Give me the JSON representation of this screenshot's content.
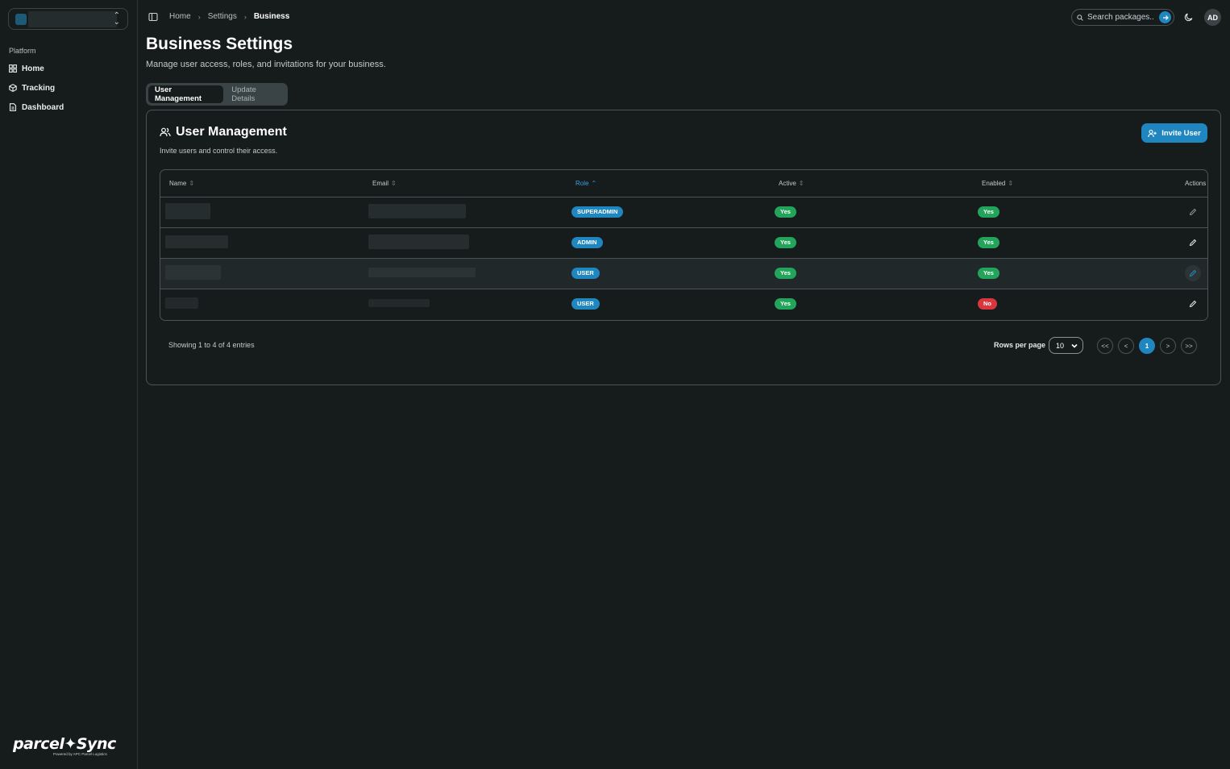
{
  "sidebar": {
    "group_label": "Platform",
    "items": [
      {
        "label": "Home"
      },
      {
        "label": "Tracking"
      },
      {
        "label": "Dashboard"
      }
    ],
    "brand_wordmark": "parcel✦Sync",
    "brand_tagline": "Powered by APC Parcel Logistics"
  },
  "breadcrumb": [
    "Home",
    "Settings",
    "Business"
  ],
  "search": {
    "placeholder": "Search packages.."
  },
  "user": {
    "initials": "AD"
  },
  "page": {
    "title": "Business Settings",
    "subtitle": "Manage user access, roles, and invitations for your business."
  },
  "tabs": [
    {
      "label": "User Management",
      "active": true
    },
    {
      "label": "Update Details",
      "active": false
    }
  ],
  "card": {
    "title": "User Management",
    "subtitle": "Invite users and control their access.",
    "invite_label": "Invite User"
  },
  "table": {
    "columns": [
      "Name",
      "Email",
      "Role",
      "Active",
      "Enabled",
      "Actions"
    ],
    "sorted_column": "Role",
    "rows": [
      {
        "role": "SUPERADMIN",
        "active": "Yes",
        "enabled": "Yes"
      },
      {
        "role": "ADMIN",
        "active": "Yes",
        "enabled": "Yes"
      },
      {
        "role": "USER",
        "active": "Yes",
        "enabled": "Yes"
      },
      {
        "role": "USER",
        "active": "Yes",
        "enabled": "No"
      }
    ]
  },
  "pagination": {
    "info": "Showing 1 to 4 of 4 entries",
    "rows_per_page_label": "Rows per page",
    "rows_per_page_value": "10",
    "first": "<<",
    "prev": "<",
    "current_page": "1",
    "next": ">",
    "last": ">>"
  },
  "colors": {
    "accent": "#1f86c0",
    "success": "#22a45a",
    "danger": "#d9363e",
    "background": "#161b1c"
  }
}
